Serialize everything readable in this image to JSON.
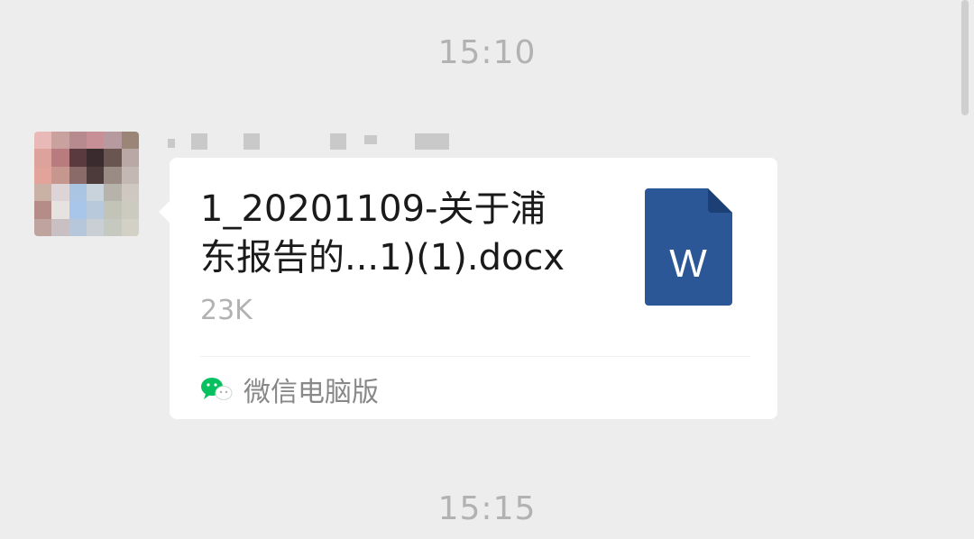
{
  "chat": {
    "timestamp_top": "15:10",
    "timestamp_bottom": "15:15",
    "message": {
      "file_name": "1_20201109-关于浦\n东报告的...1)(1).docx",
      "file_size": "23K",
      "file_icon_letter": "W",
      "file_icon": "word-document-icon",
      "file_icon_color": "#2b5797",
      "source_icon": "wechat-icon",
      "source_label": "微信电脑版"
    }
  }
}
